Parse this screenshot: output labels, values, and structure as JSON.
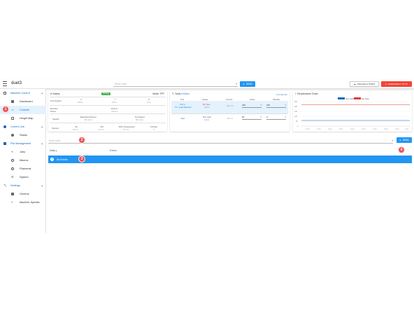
{
  "appbar": {
    "title": "duet3",
    "code_placeholder": "Send code",
    "send_label": "SEND",
    "upload_label": "UPLOAD & START",
    "estop_label": "EMERGENCY STOP"
  },
  "sidebar": {
    "groups": [
      {
        "label": "Machine Control",
        "items": [
          "Dashboard",
          "Console",
          "Height Map"
        ]
      },
      {
        "label": "Current Job",
        "items": [
          "Status"
        ]
      },
      {
        "label": "File Management",
        "items": [
          "Jobs",
          "Macros",
          "Filaments",
          "System"
        ]
      },
      {
        "label": "Settings",
        "items": [
          "General",
          "Machine-Specific"
        ]
      }
    ],
    "active_item": "Console"
  },
  "status": {
    "title": "Status",
    "badge": "Printing",
    "mode": "Mode: FFF",
    "tool_position_label": "Tool Position",
    "axes": [
      {
        "name": "X",
        "value": "229.9"
      },
      {
        "name": "Y",
        "value": "190.1"
      },
      {
        "name": "Z",
        "value": "6.10"
      }
    ],
    "extruder_label": "Extruder",
    "drives_label": "Drives",
    "drive0_label": "Drive 0",
    "drive0_value": "732.6.2",
    "speeds_label": "Speeds",
    "requested_speed_label": "Requested Speed",
    "requested_speed_value": "50 mm/s",
    "top_speed_label": "Top Speed",
    "top_speed_value": "50 mm/s",
    "sensors_label": "Sensors",
    "sensors": [
      {
        "name": "Vin",
        "value": "24.2 V"
      },
      {
        "name": "V12",
        "value": "12.2 V"
      },
      {
        "name": "MCU Temperature",
        "value": "37.4 C"
      },
      {
        "name": "Z-Probe",
        "value": "0"
      }
    ]
  },
  "tools": {
    "title": "Tools",
    "extra_label": "Extra",
    "control_all_label": "Control All",
    "headers": [
      "Tool",
      "Heater",
      "Current",
      "Active",
      "Standby"
    ],
    "rows": [
      {
        "tool": "Tool 0",
        "tool_sub": "T0 - Load Filament",
        "heater": "E0_heat",
        "heater_sub": "active",
        "current": "220.4 C",
        "active": "220",
        "standby": "220"
      },
      {
        "tool": "Bed",
        "tool_sub": "",
        "heater": "bed_heat",
        "heater_sub": "active",
        "current": "60.2 C",
        "active": "60",
        "standby": "0"
      }
    ]
  },
  "temp_chart": {
    "title": "Temperature Chart",
    "legend": [
      {
        "name": "bed_heat",
        "color": "#1565c0"
      },
      {
        "name": "E0_heat",
        "color": "#e53935"
      }
    ],
    "y_ticks": [
      "250",
      "200",
      "150",
      "100",
      "50",
      "0"
    ],
    "x_ticks": [
      "22:28",
      "22:29",
      "22:30",
      "22:31",
      "22:32",
      "22:33",
      "22:34",
      "22:35",
      "22:36",
      "22:37"
    ]
  },
  "console": {
    "placeholder": "Send code",
    "send_label": "SEND",
    "clear_label": "Clear",
    "events_label": "Events",
    "no_events": "No Events"
  },
  "callouts": [
    "1",
    "2",
    "3",
    "4"
  ],
  "colors": {
    "primary": "#2196f3",
    "danger": "#f44336",
    "success": "#4caf50"
  }
}
